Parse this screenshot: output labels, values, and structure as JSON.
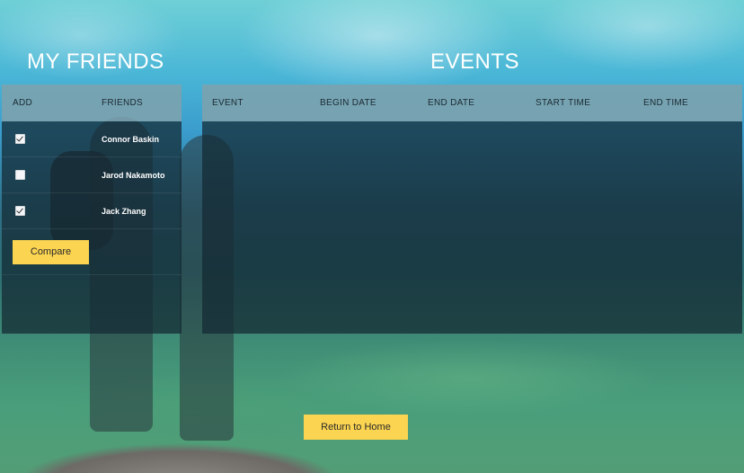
{
  "headings": {
    "friends": "MY FRIENDS",
    "events": "EVENTS"
  },
  "friends_table": {
    "columns": [
      "ADD",
      "FRIENDS"
    ],
    "rows": [
      {
        "name": "Connor Baskin",
        "checked": true
      },
      {
        "name": "Jarod Nakamoto",
        "checked": false
      },
      {
        "name": "Jack Zhang",
        "checked": true
      }
    ],
    "compare_label": "Compare"
  },
  "events_table": {
    "columns": [
      "EVENT",
      "BEGIN DATE",
      "END DATE",
      "START TIME",
      "END TIME"
    ],
    "rows": []
  },
  "home_button_label": "Return to Home",
  "colors": {
    "button_accent": "#fbd451",
    "table_header_bg": "#bfe9f3",
    "table_body_bg": "#14283280"
  }
}
